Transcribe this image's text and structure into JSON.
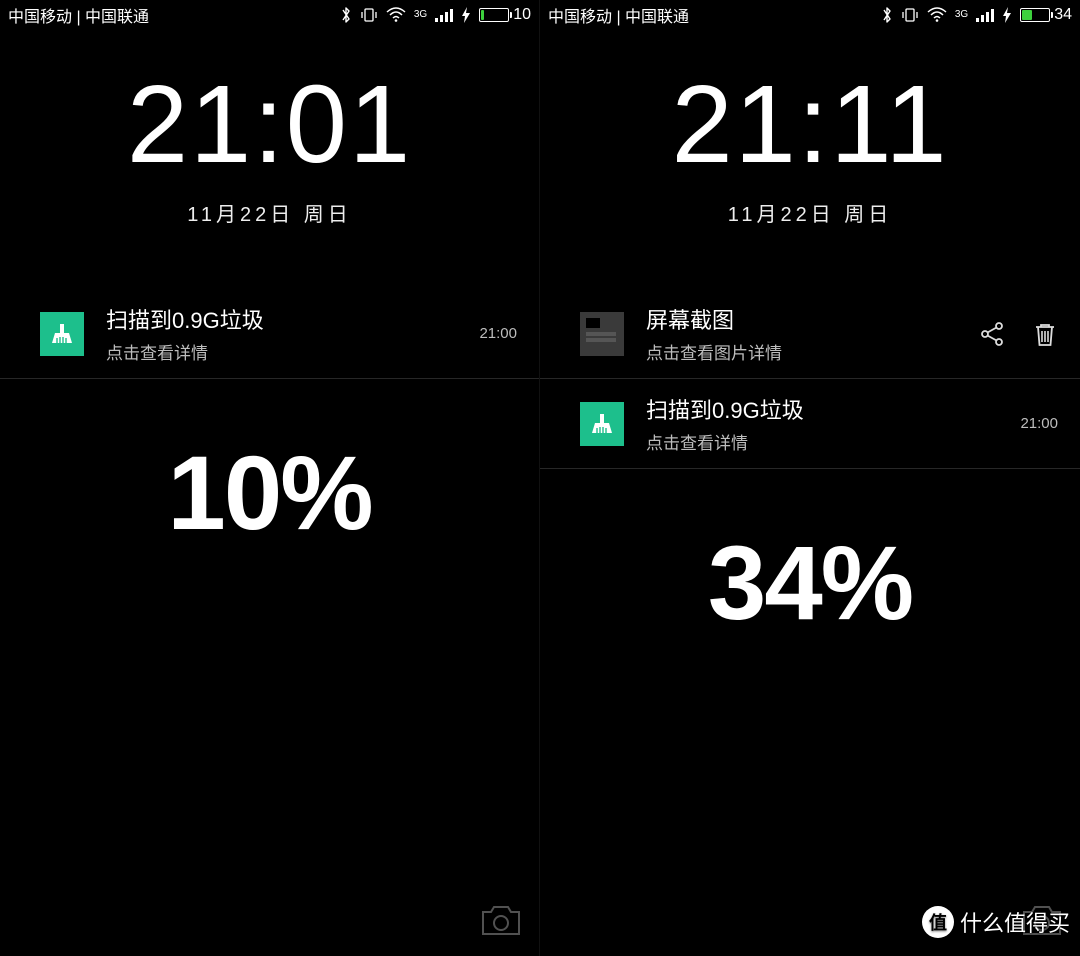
{
  "left": {
    "status": {
      "carriers": "中国移动 | 中国联通",
      "network_label": "3G",
      "battery_pct": 10,
      "battery_text": "10"
    },
    "clock": "21:01",
    "date": "11月22日  周日",
    "notifs": [
      {
        "title": "扫描到0.9G垃圾",
        "sub": "点击查看详情",
        "time": "21:00",
        "icon": "broom"
      }
    ],
    "percent": "10%"
  },
  "right": {
    "status": {
      "carriers": "中国移动 | 中国联通",
      "network_label": "3G",
      "battery_pct": 34,
      "battery_text": "34"
    },
    "clock": "21:11",
    "date": "11月22日  周日",
    "notifs": [
      {
        "title": "屏幕截图",
        "sub": "点击查看图片详情",
        "time": "",
        "icon": "thumb",
        "actions": true
      },
      {
        "title": "扫描到0.9G垃圾",
        "sub": "点击查看详情",
        "time": "21:00",
        "icon": "broom"
      }
    ],
    "percent": "34%"
  },
  "watermark": {
    "badge": "值",
    "text": "什么值得买"
  }
}
